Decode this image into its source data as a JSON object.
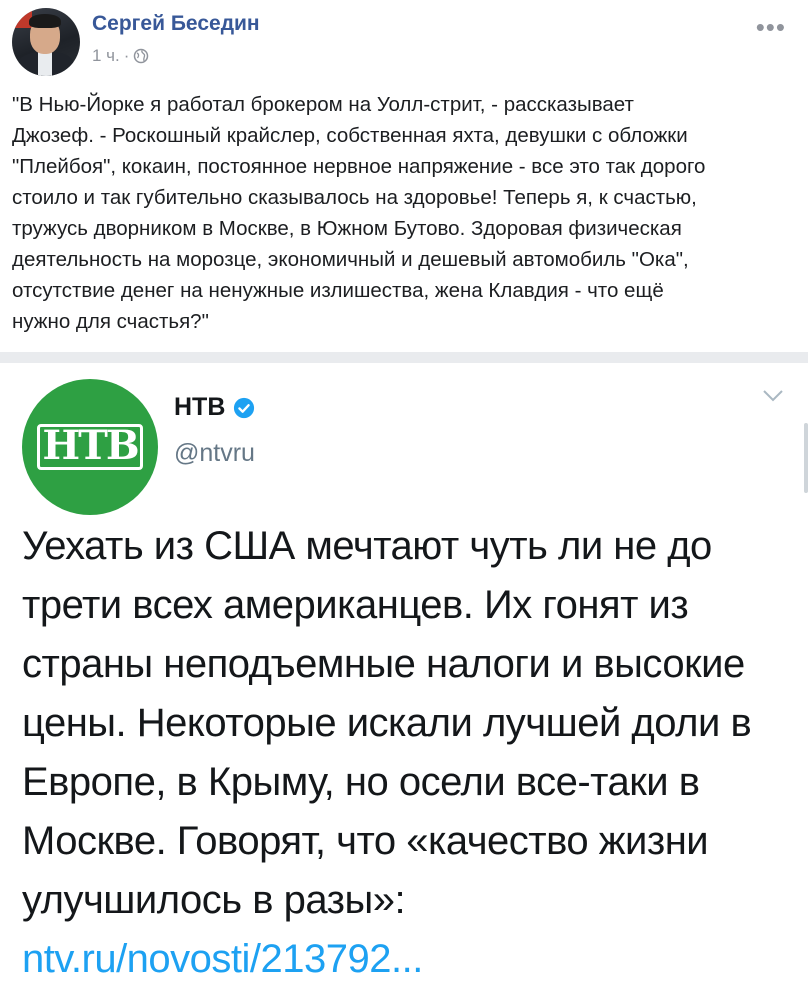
{
  "post": {
    "author": "Сергей Беседин",
    "time": "1 ч.",
    "separator": "·",
    "more_icon": "more-horizontal-icon",
    "privacy_icon": "globe-icon",
    "text": "\"В Нью-Йорке я работал брокером на Уолл-стрит, - рассказывает\nДжозеф. - Роскошный крайслер, собственная яхта, девушки с обложки\n\"Плейбоя\", кокаин, постоянное нервное напряжение - все это так дорого\nстоило и так губительно сказывалось на здоровье! Теперь я, к счастью,\nтружусь дворником в Москве, в Южном Бутово. Здоровая физическая\nдеятельность на морозце, экономичный и дешевый автомобиль \"Ока\",\nотсутствие денег на ненужные излишества, жена Клавдия - что ещё\nнужно для счастья?\""
  },
  "tweet": {
    "name": "НТВ",
    "handle": "@ntvru",
    "verified_icon": "verified-badge-icon",
    "logo_text": "НТВ",
    "logo_color": "#2ea043",
    "body": "Уехать из США мечтают чуть ли не до трети всех американцев. Их гонят из страны неподъемные налоги и высокие цены. Некоторые искали лучшей доли в Европе, в Крыму, но осели все-таки в Москве. Говорят, что «качество жизни улучшилось в разы»: ",
    "link": "ntv.ru/novosti/213792...",
    "link_color": "#1da1f2"
  }
}
